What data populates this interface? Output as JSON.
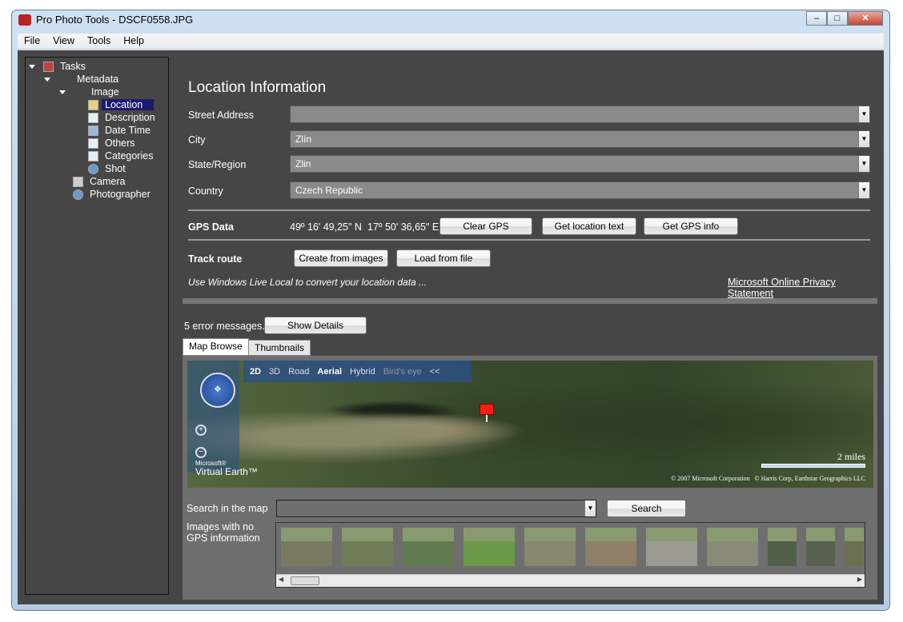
{
  "window": {
    "title": "Pro Photo Tools - DSCF0558.JPG",
    "controls": {
      "minimize": "–",
      "maximize": "□",
      "close": "✕"
    }
  },
  "menu": [
    "File",
    "View",
    "Tools",
    "Help"
  ],
  "tree": {
    "items": [
      {
        "label": "Tasks",
        "icon": "tasks-icon"
      },
      {
        "label": "Metadata"
      },
      {
        "label": "Image"
      },
      {
        "label": "Location",
        "icon": "map-icon",
        "selected": true
      },
      {
        "label": "Description",
        "icon": "document-icon"
      },
      {
        "label": "Date Time",
        "icon": "calendar-icon"
      },
      {
        "label": "Others",
        "icon": "list-icon"
      },
      {
        "label": "Categories",
        "icon": "list-icon"
      },
      {
        "label": "Shot",
        "icon": "person-icon"
      },
      {
        "label": "Camera",
        "icon": "camera-icon"
      },
      {
        "label": "Photographer",
        "icon": "person-icon"
      }
    ]
  },
  "main": {
    "title": "Location Information",
    "fields": [
      {
        "label": "Street Address",
        "value": ""
      },
      {
        "label": "City",
        "value": "Zlín"
      },
      {
        "label": "State/Region",
        "value": "Zlin"
      },
      {
        "label": "Country",
        "value": "Czech Republic"
      }
    ],
    "gps": {
      "label": "GPS Data",
      "lat": "49º 16' 49,25\" N",
      "lon": "17º 50' 36,65\" E",
      "clear": "Clear GPS",
      "get_text": "Get location text",
      "get_info": "Get GPS info"
    },
    "track": {
      "label": "Track route",
      "create": "Create from images",
      "load": "Load from file"
    },
    "hint": "Use Windows Live Local to convert your location data ...",
    "privacy_link": "Microsoft Online Privacy Statement",
    "errors": "5 error messages.",
    "show_details": "Show Details",
    "tabs": [
      "Map Browse",
      "Thumbnails"
    ],
    "map": {
      "modes": [
        "2D",
        "3D",
        "Road",
        "Aerial",
        "Hybrid",
        "Bird's eye",
        "<<"
      ],
      "active_dim": "2D",
      "active_style": "Aerial",
      "brand_small": "Microsoft®",
      "brand": "Virtual Earth™",
      "scale": "2 miles",
      "copyright1": "© 2007 Microsoft Corporation",
      "copyright2": "© Harris Corp, Earthstar Geographics LLC"
    },
    "search_label": "Search in the map",
    "search_value": "",
    "search_button": "Search",
    "no_gps_label": "Images with no GPS information",
    "thumbnail_colors": [
      "#7a7a62",
      "#6e7c58",
      "#5f7a4e",
      "#6a9a48",
      "#8a8670",
      "#8e8068",
      "#9a9a90",
      "#8a8a78",
      "#506048",
      "#586050",
      "#6a7050"
    ]
  }
}
